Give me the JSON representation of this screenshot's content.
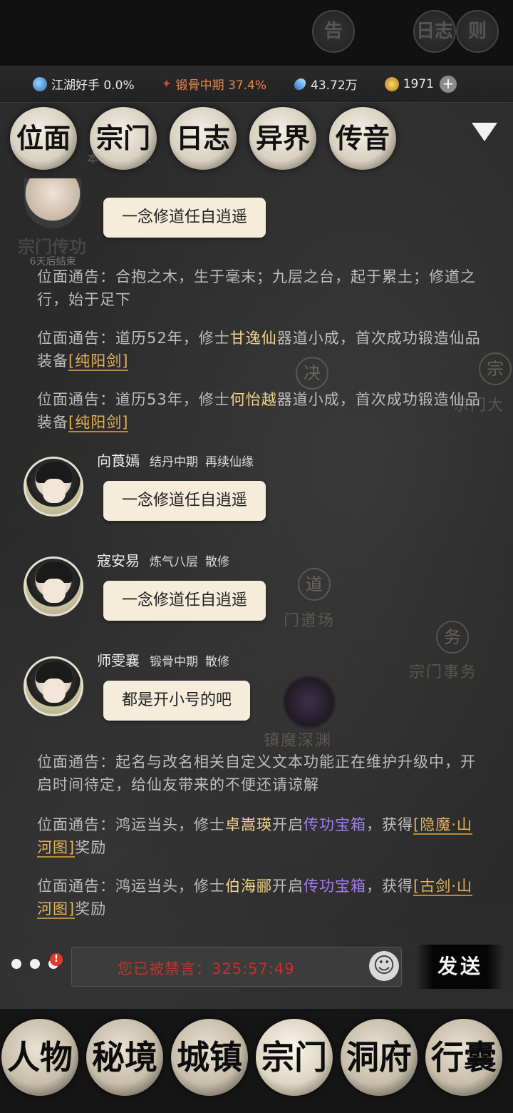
{
  "status": {
    "realm": "江湖好手 0.0%",
    "cultivation": "锻骨中期 37.4%",
    "spirit_stones": "43.72万",
    "gold": "1971",
    "plus": "+"
  },
  "tabs": [
    {
      "label": "位面"
    },
    {
      "label": "宗门"
    },
    {
      "label": "日志"
    },
    {
      "label": "异界"
    },
    {
      "label": "传音"
    }
  ],
  "hidden_tabs": [
    "告",
    "日志",
    "则"
  ],
  "header_sub": "本宗门贡献:",
  "event_badge": {
    "title": "宗门传功",
    "subtitle": "6天后结束"
  },
  "messages": [
    {
      "type": "bubble",
      "text": "一念修道任自逍遥"
    },
    {
      "type": "notice",
      "prefix": "位面通告：",
      "text": "合抱之木，生于毫末；九层之台，起于累土；修道之行，始于足下"
    },
    {
      "type": "notice",
      "prefix": "位面通告：",
      "pre": "道历52年，修士",
      "name": "甘逸仙",
      "mid": "器道小成，首次成功锻造仙品装备",
      "item": "[纯阳剑]"
    },
    {
      "type": "notice",
      "prefix": "位面通告：",
      "pre": "道历53年，修士",
      "name": "何怡越",
      "mid": "器道小成，首次成功锻造仙品装备",
      "item": "[纯阳剑]"
    },
    {
      "type": "chat",
      "name": "向莨嫣",
      "realm": "结丹中期",
      "sect": "再续仙缘",
      "text": "一念修道任自逍遥"
    },
    {
      "type": "chat",
      "name": "寇安易",
      "realm": "炼气八层",
      "sect": "散修",
      "text": "一念修道任自逍遥"
    },
    {
      "type": "chat",
      "name": "师雯襄",
      "realm": "锻骨中期",
      "sect": "散修",
      "text": "都是开小号的吧"
    },
    {
      "type": "notice",
      "prefix": "位面通告：",
      "text": "起名与改名相关自定义文本功能正在维护升级中，开启时间待定，给仙友带来的不便还请谅解"
    },
    {
      "type": "notice",
      "prefix": "位面通告：",
      "pre": "鸿运当头，修士",
      "name": "卓嵩瑛",
      "mid": "开启",
      "box": "传功宝箱",
      "mid2": "，获得",
      "item": "[隐魔·山河图]",
      "post": "奖励"
    },
    {
      "type": "notice",
      "prefix": "位面通告：",
      "pre": "鸿运当头，修士",
      "name": "伯海郦",
      "mid": "开启",
      "box": "传功宝箱",
      "mid2": "，获得",
      "item": "[古剑·山河图]",
      "post": "奖励"
    }
  ],
  "background_marks": {
    "jue": "决",
    "zong": "宗",
    "dao": "道",
    "wu": "务",
    "label_daochang": "门道场",
    "label_shiwu": "宗门事务",
    "label_shenyuan": "镇魔深渊",
    "label_zongmen": "宗门大"
  },
  "input": {
    "text": "您已被禁言：325:57:49",
    "notify": "!",
    "emoji": "☺",
    "send_label": "发送"
  },
  "bottom_nav": [
    {
      "label": "人物"
    },
    {
      "label": "秘境"
    },
    {
      "label": "城镇"
    },
    {
      "label": "宗门"
    },
    {
      "label": "洞府"
    },
    {
      "label": "行囊"
    }
  ]
}
